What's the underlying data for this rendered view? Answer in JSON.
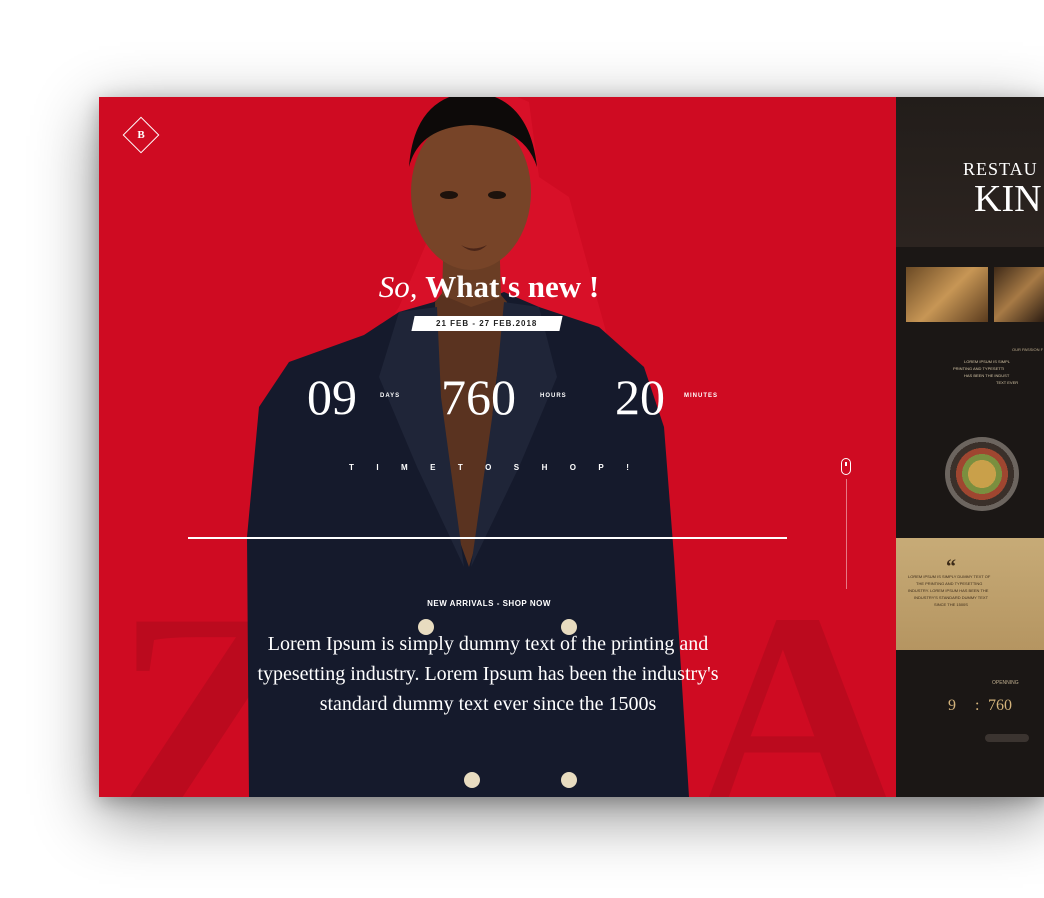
{
  "hero": {
    "logo_letter": "B",
    "background_letters": [
      "Z",
      "A"
    ],
    "headline_italic": "So,",
    "headline_bold": "What's new !",
    "date_range": "21 FEB - 27 FEB.2018",
    "countdown": [
      {
        "value": "09",
        "unit": "DAYS"
      },
      {
        "value": "760",
        "unit": "HOURS"
      },
      {
        "value": "20",
        "unit": "MINUTES"
      }
    ],
    "tagline_letters": [
      "T",
      "I",
      "M",
      "E",
      "T",
      "O",
      "S",
      "H",
      "O",
      "P",
      "!"
    ],
    "cta": "NEW ARRIVALS - SHOP NOW",
    "lead": "Lorem Ipsum is simply dummy text of the printing and typesetting industry. Lorem Ipsum has been the industry's standard dummy text ever since the 1500s",
    "colors": {
      "accent": "#cf0b22",
      "jacket": "#151a2c"
    }
  },
  "restaurant": {
    "title_line1": "RESTAU",
    "title_line2": "KIN",
    "passion_label": "OUR PASSION F",
    "passion_text": [
      "LOREM IPSUM IS SIMPL",
      "PRINTING AND TYPESETTI",
      "HAS BEEN THE INDUST",
      "TEXT EVER"
    ],
    "quote_mark": "“",
    "quote_text": [
      "LOREM IPSUM IS SIMPLY DUMMY TEXT OF",
      "THE PRINTING AND TYPESETTING",
      "INDUSTRY. LOREM IPSUM HAS BEEN THE",
      "INDUSTRY'S STANDARD DUMMY TEXT",
      "SINCE THE 1500S"
    ],
    "opening_label": "OPENNING",
    "count_days": "9",
    "count_separator": ":",
    "count_hours": "760",
    "colors": {
      "panel": "#1b1715",
      "gold": "#c7ab77"
    }
  }
}
